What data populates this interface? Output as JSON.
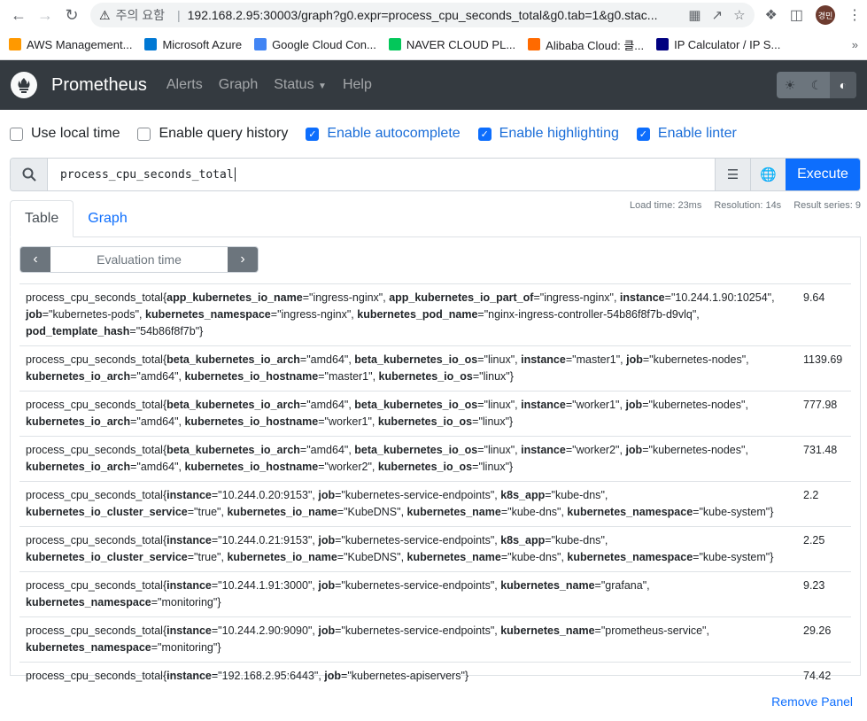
{
  "browser": {
    "security_label": "주의 요함",
    "url": "192.168.2.95:30003/graph?g0.expr=process_cpu_seconds_total&g0.tab=1&g0.stac...",
    "profile_initials": "경민",
    "bookmarks": [
      {
        "label": "AWS Management...",
        "icon": "aws-icon",
        "color": "#ff9900"
      },
      {
        "label": "Microsoft Azure",
        "icon": "azure-icon",
        "color": "#0078d4"
      },
      {
        "label": "Google Cloud Con...",
        "icon": "google-cloud-icon",
        "color": "#4285f4"
      },
      {
        "label": "NAVER CLOUD PL...",
        "icon": "naver-cloud-icon",
        "color": "#03c75a"
      },
      {
        "label": "Alibaba Cloud: 클...",
        "icon": "alibaba-icon",
        "color": "#ff6a00"
      },
      {
        "label": "IP Calculator / IP S...",
        "icon": "ip-calculator-icon",
        "color": "#000080"
      }
    ]
  },
  "navbar": {
    "brand": "Prometheus",
    "links": [
      "Alerts",
      "Graph",
      "Status",
      "Help"
    ]
  },
  "options": [
    {
      "label": "Use local time",
      "checked": false
    },
    {
      "label": "Enable query history",
      "checked": false
    },
    {
      "label": "Enable autocomplete",
      "checked": true
    },
    {
      "label": "Enable highlighting",
      "checked": true
    },
    {
      "label": "Enable linter",
      "checked": true
    }
  ],
  "query": {
    "expression": "process_cpu_seconds_total",
    "execute_label": "Execute"
  },
  "tabs": {
    "table": "Table",
    "graph": "Graph"
  },
  "stats": {
    "load_time": "Load time: 23ms",
    "resolution": "Resolution: 14s",
    "result_series": "Result series: 9"
  },
  "evaluation_time_placeholder": "Evaluation time",
  "metric_name": "process_cpu_seconds_total",
  "results": [
    {
      "labels": [
        [
          "app_kubernetes_io_name",
          "ingress-nginx"
        ],
        [
          "app_kubernetes_io_part_of",
          "ingress-nginx"
        ],
        [
          "instance",
          "10.244.1.90:10254"
        ],
        [
          "job",
          "kubernetes-pods"
        ],
        [
          "kubernetes_namespace",
          "ingress-nginx"
        ],
        [
          "kubernetes_pod_name",
          "nginx-ingress-controller-54b86f8f7b-d9vlq"
        ],
        [
          "pod_template_hash",
          "54b86f8f7b"
        ]
      ],
      "value": "9.64"
    },
    {
      "labels": [
        [
          "beta_kubernetes_io_arch",
          "amd64"
        ],
        [
          "beta_kubernetes_io_os",
          "linux"
        ],
        [
          "instance",
          "master1"
        ],
        [
          "job",
          "kubernetes-nodes"
        ],
        [
          "kubernetes_io_arch",
          "amd64"
        ],
        [
          "kubernetes_io_hostname",
          "master1"
        ],
        [
          "kubernetes_io_os",
          "linux"
        ]
      ],
      "value": "1139.69"
    },
    {
      "labels": [
        [
          "beta_kubernetes_io_arch",
          "amd64"
        ],
        [
          "beta_kubernetes_io_os",
          "linux"
        ],
        [
          "instance",
          "worker1"
        ],
        [
          "job",
          "kubernetes-nodes"
        ],
        [
          "kubernetes_io_arch",
          "amd64"
        ],
        [
          "kubernetes_io_hostname",
          "worker1"
        ],
        [
          "kubernetes_io_os",
          "linux"
        ]
      ],
      "value": "777.98"
    },
    {
      "labels": [
        [
          "beta_kubernetes_io_arch",
          "amd64"
        ],
        [
          "beta_kubernetes_io_os",
          "linux"
        ],
        [
          "instance",
          "worker2"
        ],
        [
          "job",
          "kubernetes-nodes"
        ],
        [
          "kubernetes_io_arch",
          "amd64"
        ],
        [
          "kubernetes_io_hostname",
          "worker2"
        ],
        [
          "kubernetes_io_os",
          "linux"
        ]
      ],
      "value": "731.48"
    },
    {
      "labels": [
        [
          "instance",
          "10.244.0.20:9153"
        ],
        [
          "job",
          "kubernetes-service-endpoints"
        ],
        [
          "k8s_app",
          "kube-dns"
        ],
        [
          "kubernetes_io_cluster_service",
          "true"
        ],
        [
          "kubernetes_io_name",
          "KubeDNS"
        ],
        [
          "kubernetes_name",
          "kube-dns"
        ],
        [
          "kubernetes_namespace",
          "kube-system"
        ]
      ],
      "value": "2.2"
    },
    {
      "labels": [
        [
          "instance",
          "10.244.0.21:9153"
        ],
        [
          "job",
          "kubernetes-service-endpoints"
        ],
        [
          "k8s_app",
          "kube-dns"
        ],
        [
          "kubernetes_io_cluster_service",
          "true"
        ],
        [
          "kubernetes_io_name",
          "KubeDNS"
        ],
        [
          "kubernetes_name",
          "kube-dns"
        ],
        [
          "kubernetes_namespace",
          "kube-system"
        ]
      ],
      "value": "2.25"
    },
    {
      "labels": [
        [
          "instance",
          "10.244.1.91:3000"
        ],
        [
          "job",
          "kubernetes-service-endpoints"
        ],
        [
          "kubernetes_name",
          "grafana"
        ],
        [
          "kubernetes_namespace",
          "monitoring"
        ]
      ],
      "value": "9.23"
    },
    {
      "labels": [
        [
          "instance",
          "10.244.2.90:9090"
        ],
        [
          "job",
          "kubernetes-service-endpoints"
        ],
        [
          "kubernetes_name",
          "prometheus-service"
        ],
        [
          "kubernetes_namespace",
          "monitoring"
        ]
      ],
      "value": "29.26"
    },
    {
      "labels": [
        [
          "instance",
          "192.168.2.95:6443"
        ],
        [
          "job",
          "kubernetes-apiservers"
        ]
      ],
      "value": "74.42"
    }
  ],
  "remove_panel": "Remove Panel"
}
